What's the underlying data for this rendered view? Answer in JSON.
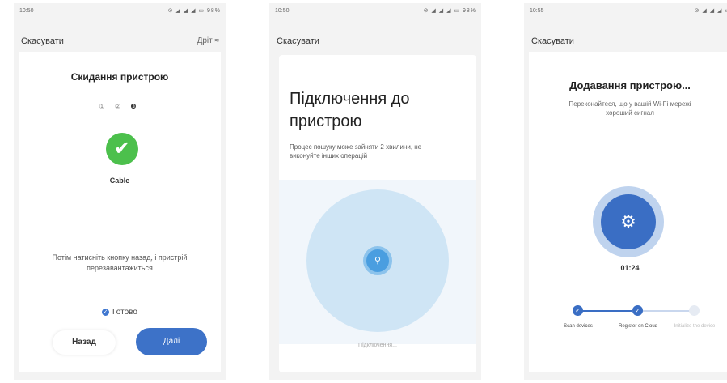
{
  "screens": [
    {
      "time": "10:50",
      "status_icons": "⊘ ◢ ◢ ◢ ▭ 98%",
      "cancel": "Скасувати",
      "next_top": "Дріт ≈",
      "title": "Скидання пристрою",
      "steps": [
        "①",
        "②",
        "❸"
      ],
      "check_icon": "✔",
      "device": "Cable",
      "hint": "Потім натисніть кнопку назад, і пристрій перезавантажиться",
      "done_label": "Готово",
      "back_button": "Назад",
      "next_button": "Далі"
    },
    {
      "time": "10:50",
      "status_icons": "⊘ ◢ ◢ ◢ ▭ 98%",
      "cancel": "Скасувати",
      "title": "Підключення до пристрою",
      "process_text": "Процес пошуку може зайняти 2 хвилини, не виконуйте інших операцій",
      "search_icon": "⚲",
      "connecting": "Підключення..."
    },
    {
      "time": "10:55",
      "status_icons": "⊘ ◢ ◢ ◢ ▭",
      "cancel": "Скасувати",
      "title": "Додавання пристрою...",
      "subtitle": "Переконайтеся, що у вашій Wi-Fi мережі хороший сигнал",
      "gear_icon": "⚙",
      "timer": "01:24",
      "steps": [
        {
          "label": "Scan devices",
          "done": true
        },
        {
          "label": "Register on Cloud",
          "done": true
        },
        {
          "label": "Initialize the device",
          "done": false
        }
      ]
    }
  ],
  "colors": {
    "accent": "#3d72c8",
    "success": "#4cc04c",
    "search": "#4a9ee0"
  }
}
